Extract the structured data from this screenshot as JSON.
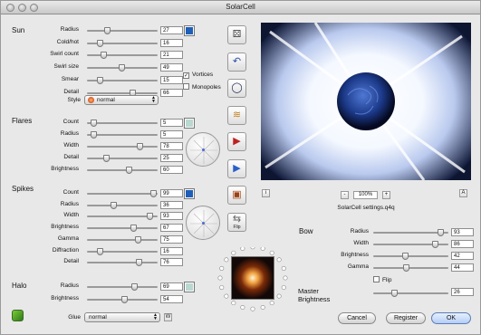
{
  "window": {
    "title": "SolarCell"
  },
  "sun": {
    "heading": "Sun",
    "params": [
      {
        "label": "Radius",
        "value": "27",
        "level": 0.27
      },
      {
        "label": "Cold/hot",
        "value": "16",
        "level": 0.16
      },
      {
        "label": "Swirl count",
        "value": "21",
        "level": 0.21
      },
      {
        "label": "Swirl size",
        "value": "49",
        "level": 0.49
      },
      {
        "label": "Smear",
        "value": "15",
        "level": 0.15
      },
      {
        "label": "Detail",
        "value": "66",
        "level": 0.66
      }
    ],
    "style_label": "Style",
    "style_value": "normal",
    "vortices_label": "Vortices",
    "vortices_checked": true,
    "monopoles_label": "Monopoles",
    "monopoles_checked": false,
    "color": "#1f5fb8"
  },
  "flares": {
    "heading": "Flares",
    "params": [
      {
        "label": "Count",
        "value": "5",
        "level": 0.05
      },
      {
        "label": "Radius",
        "value": "5",
        "level": 0.05
      },
      {
        "label": "Width",
        "value": "78",
        "level": 0.78
      },
      {
        "label": "Detail",
        "value": "25",
        "level": 0.25
      },
      {
        "label": "Brightness",
        "value": "60",
        "level": 0.6
      }
    ],
    "color": "#b8d8d0"
  },
  "spikes": {
    "heading": "Spikes",
    "params": [
      {
        "label": "Count",
        "value": "99",
        "level": 0.99
      },
      {
        "label": "Radius",
        "value": "36",
        "level": 0.36
      },
      {
        "label": "Width",
        "value": "93",
        "level": 0.93
      },
      {
        "label": "Brightness",
        "value": "67",
        "level": 0.67
      },
      {
        "label": "Gamma",
        "value": "75",
        "level": 0.75
      },
      {
        "label": "Diffraction",
        "value": "16",
        "level": 0.16
      },
      {
        "label": "Detail",
        "value": "76",
        "level": 0.76
      }
    ],
    "color": "#1f5fb8"
  },
  "halo": {
    "heading": "Halo",
    "params": [
      {
        "label": "Radius",
        "value": "69",
        "level": 0.69
      },
      {
        "label": "Brightness",
        "value": "54",
        "level": 0.54
      }
    ],
    "color": "#b8d8d0"
  },
  "glue": {
    "label": "Glue",
    "value": "normal",
    "w_label": "W"
  },
  "bow": {
    "heading": "Bow",
    "params": [
      {
        "label": "Radius",
        "value": "93",
        "level": 0.93
      },
      {
        "label": "Width",
        "value": "86",
        "level": 0.86
      },
      {
        "label": "Brightness",
        "value": "42",
        "level": 0.42
      },
      {
        "label": "Gamma",
        "value": "44",
        "level": 0.44
      }
    ],
    "flip_label": "Flip",
    "flip_checked": false
  },
  "master": {
    "label_line1": "Master",
    "label_line2": "Brightness",
    "value": "26",
    "level": 0.26
  },
  "preview": {
    "zoom": "100%",
    "zoom_out": "-",
    "zoom_in": "+",
    "info": "i",
    "expand": "A",
    "filename": "SolarCell settings.q4q"
  },
  "toolbar": {
    "tools": [
      {
        "name": "random-dice-icon",
        "glyph": "⚄"
      },
      {
        "name": "undo-icon",
        "glyph": "↶"
      },
      {
        "name": "ring-icon",
        "glyph": "◯"
      },
      {
        "name": "gradient-icon",
        "glyph": "≋"
      },
      {
        "name": "play-red-icon",
        "glyph": "▶"
      },
      {
        "name": "play-blue-icon",
        "glyph": "▶"
      },
      {
        "name": "photo-icon",
        "glyph": "▣"
      },
      {
        "name": "flip-icon",
        "glyph": "⇆"
      }
    ],
    "flip_text": "Flip"
  },
  "buttons": {
    "cancel": "Cancel",
    "register": "Register",
    "ok": "OK"
  }
}
